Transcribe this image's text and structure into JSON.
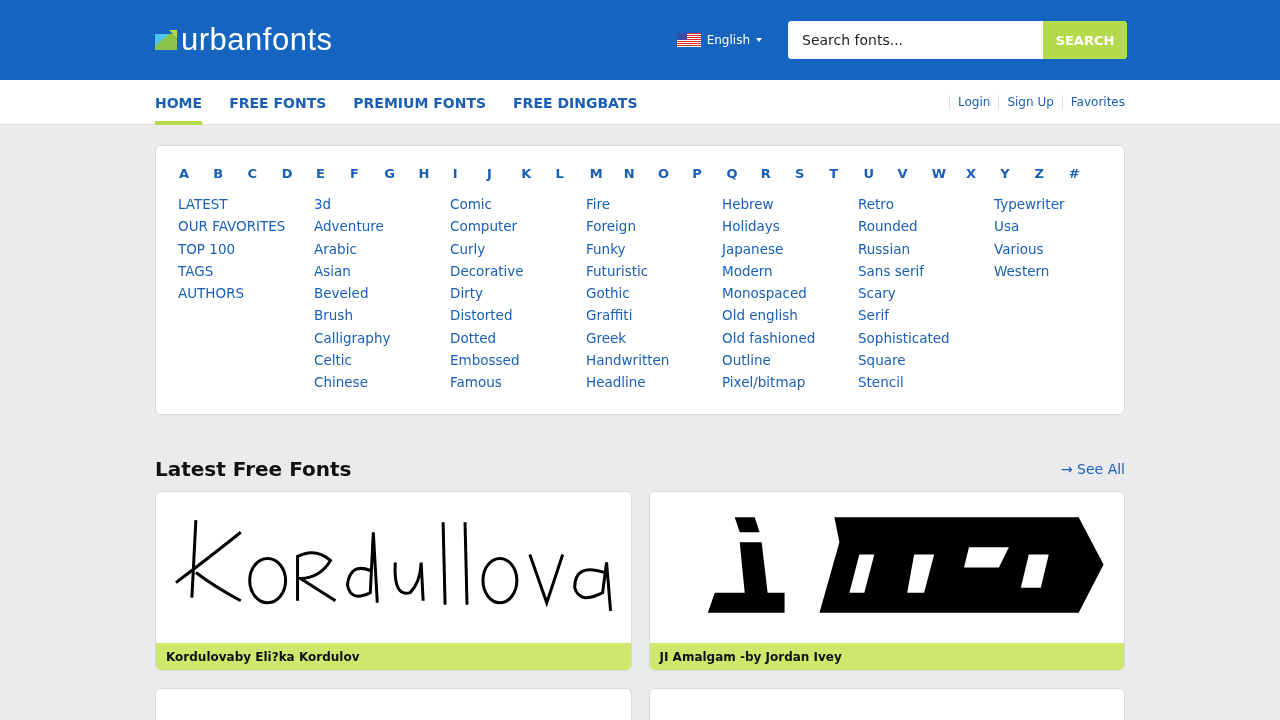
{
  "header": {
    "logo": "urbanfonts",
    "language": "English",
    "search": {
      "placeholder": "Search fonts...",
      "button": "SEARCH"
    }
  },
  "nav": {
    "items": [
      {
        "label": "HOME",
        "selected": true
      },
      {
        "label": "FREE FONTS",
        "selected": false
      },
      {
        "label": "PREMIUM FONTS",
        "selected": false
      },
      {
        "label": "FREE DINGBATS",
        "selected": false
      }
    ],
    "account_links": [
      "Login",
      "Sign Up",
      "Favorites"
    ]
  },
  "alphabet": [
    "A",
    "B",
    "C",
    "D",
    "E",
    "F",
    "G",
    "H",
    "I",
    "J",
    "K",
    "L",
    "M",
    "N",
    "O",
    "P",
    "Q",
    "R",
    "S",
    "T",
    "U",
    "V",
    "W",
    "X",
    "Y",
    "Z",
    "#"
  ],
  "categories": [
    [
      "LATEST",
      "OUR FAVORITES",
      "TOP 100",
      "TAGS",
      "AUTHORS"
    ],
    [
      "3d",
      "Adventure",
      "Arabic",
      "Asian",
      "Beveled",
      "Brush",
      "Calligraphy",
      "Celtic",
      "Chinese"
    ],
    [
      "Comic",
      "Computer",
      "Curly",
      "Decorative",
      "Dirty",
      "Distorted",
      "Dotted",
      "Embossed",
      "Famous"
    ],
    [
      "Fire",
      "Foreign",
      "Funky",
      "Futuristic",
      "Gothic",
      "Graffiti",
      "Greek",
      "Handwritten",
      "Headline"
    ],
    [
      "Hebrew",
      "Holidays",
      "Japanese",
      "Modern",
      "Monospaced",
      "Old english",
      "Old fashioned",
      "Outline",
      "Pixel/bitmap"
    ],
    [
      "Retro",
      "Rounded",
      "Russian",
      "Sans serif",
      "Scary",
      "Serif",
      "Sophisticated",
      "Square",
      "Stencil"
    ],
    [
      "Typewriter",
      "Usa",
      "Various",
      "Western"
    ]
  ],
  "latest": {
    "title": "Latest Free Fonts",
    "see_all": "→ See All",
    "cards": [
      {
        "kind": "picture",
        "caption": "Kordulovaby Eli?ka Kordulov"
      },
      {
        "kind": "picture",
        "caption": "JI Amalgam -by Jordan Ivey"
      },
      {
        "kind": "empty"
      },
      {
        "kind": "empty"
      }
    ]
  }
}
